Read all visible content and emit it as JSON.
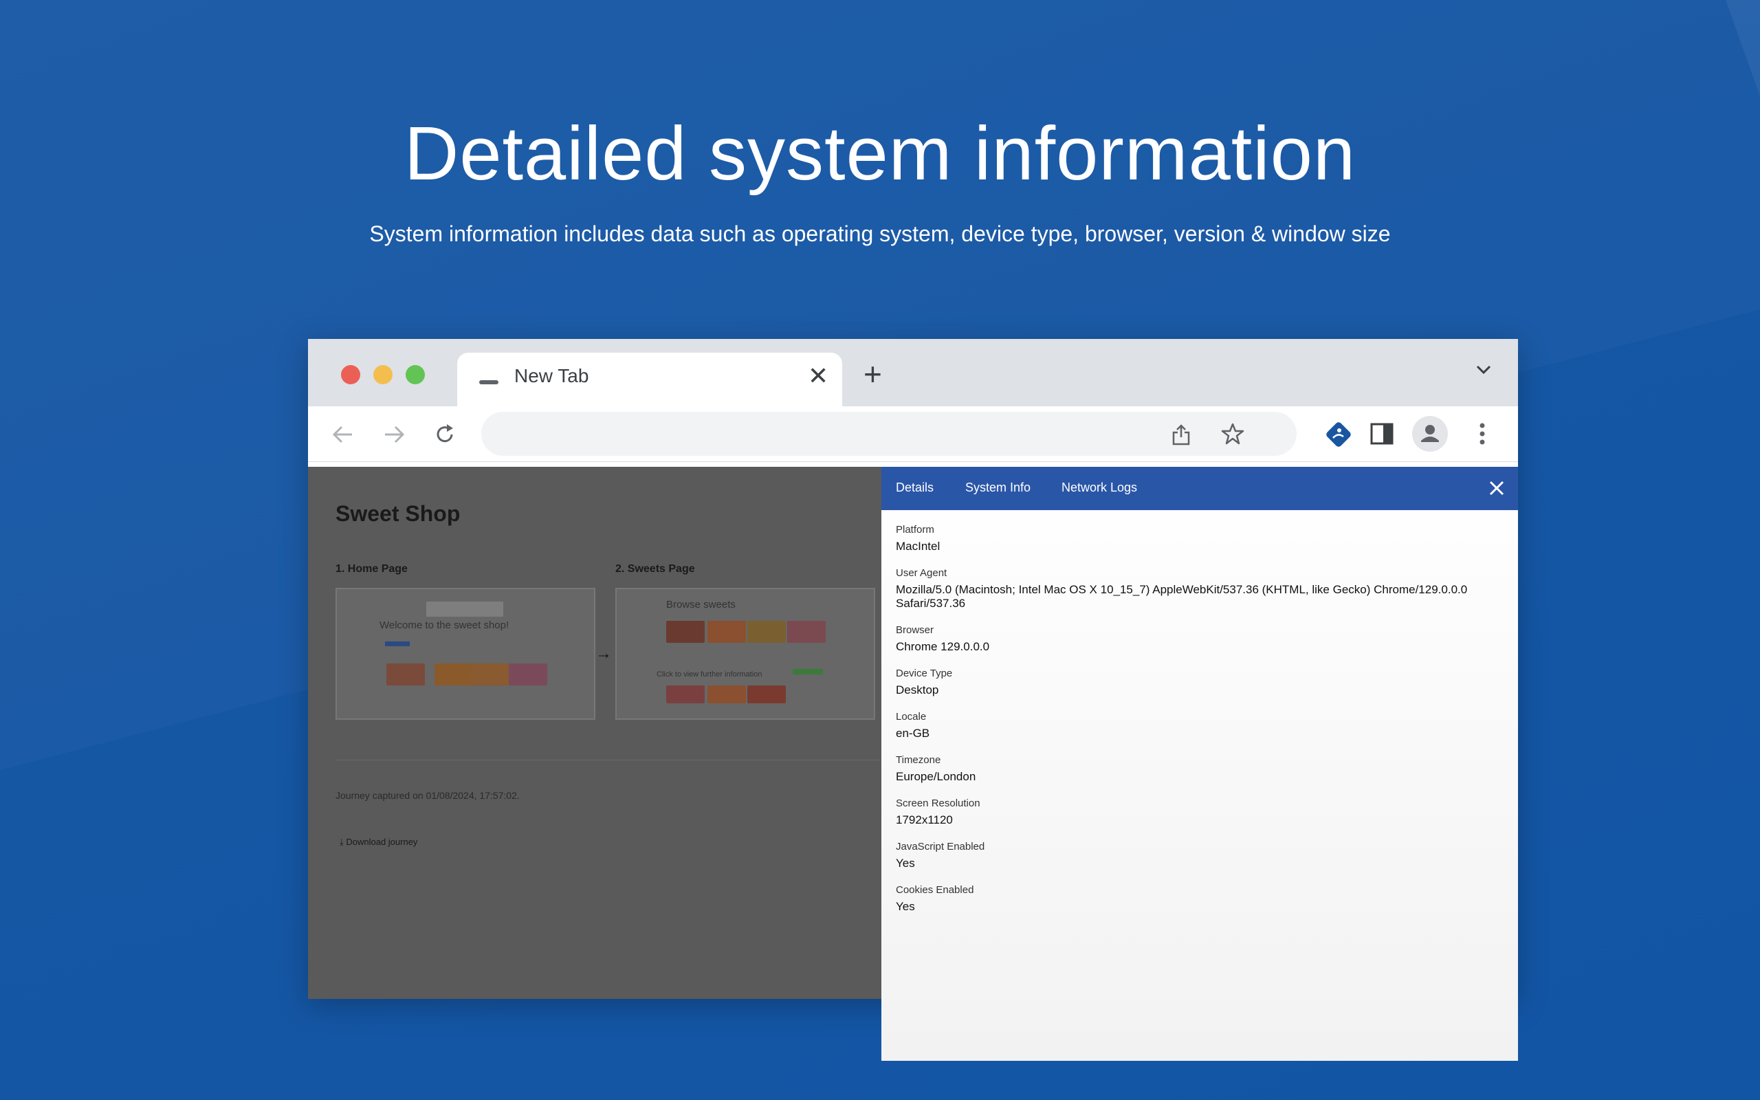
{
  "headline": "Detailed system information",
  "subline": "System information includes data such as operating system, device type, browser, version & window size",
  "browser": {
    "tab_title": "New Tab",
    "new_tab_symbol": "+"
  },
  "page": {
    "shop_title": "Sweet Shop",
    "steps": [
      "1. Home Page",
      "2. Sweets Page"
    ],
    "thumb_headings": [
      "Welcome to the sweet shop!",
      "Browse sweets"
    ],
    "thumb_overlay": "Click to view further information",
    "captured": "Journey captured on 01/08/2024, 17:57:02.",
    "download": "Download journey"
  },
  "panel": {
    "tabs": [
      "Details",
      "System Info",
      "Network Logs"
    ],
    "fields": [
      {
        "label": "Platform",
        "value": "MacIntel"
      },
      {
        "label": "User Agent",
        "value": "Mozilla/5.0 (Macintosh; Intel Mac OS X 10_15_7) AppleWebKit/537.36 (KHTML, like Gecko) Chrome/129.0.0.0",
        "value2": "Safari/537.36"
      },
      {
        "label": "Browser",
        "value": "Chrome 129.0.0.0"
      },
      {
        "label": "Device Type",
        "value": "Desktop"
      },
      {
        "label": "Locale",
        "value": "en-GB"
      },
      {
        "label": "Timezone",
        "value": "Europe/London"
      },
      {
        "label": "Screen Resolution",
        "value": "1792x1120"
      },
      {
        "label": "JavaScript Enabled",
        "value": "Yes"
      },
      {
        "label": "Cookies Enabled",
        "value": "Yes"
      }
    ]
  },
  "colors": {
    "background": "#1657a4",
    "panel_header": "#2a56a8",
    "extension_icon": "#1a55a0"
  }
}
